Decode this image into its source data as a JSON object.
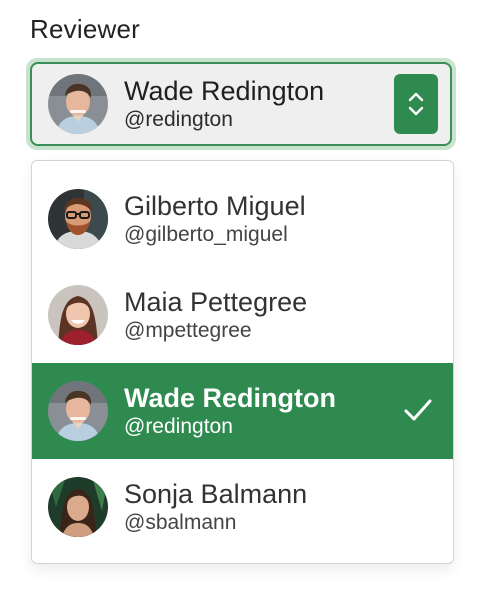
{
  "field": {
    "label": "Reviewer"
  },
  "selected": {
    "name": "Wade Redington",
    "handle": "@redington",
    "avatar_icon": "avatar-wade-icon"
  },
  "stepper_icon": "chevron-up-down-icon",
  "options": [
    {
      "name": "Gilberto Miguel",
      "handle": "@gilberto_miguel",
      "avatar_icon": "avatar-gilberto-icon",
      "selected": false
    },
    {
      "name": "Maia Pettegree",
      "handle": "@mpettegree",
      "avatar_icon": "avatar-maia-icon",
      "selected": false
    },
    {
      "name": "Wade Redington",
      "handle": "@redington",
      "avatar_icon": "avatar-wade-icon",
      "selected": true
    },
    {
      "name": "Sonja Balmann",
      "handle": "@sbalmann",
      "avatar_icon": "avatar-sonja-icon",
      "selected": false
    }
  ],
  "colors": {
    "accent": "#2f8a50",
    "focus_ring": "#c9e3cf",
    "select_bg": "#efefef"
  }
}
